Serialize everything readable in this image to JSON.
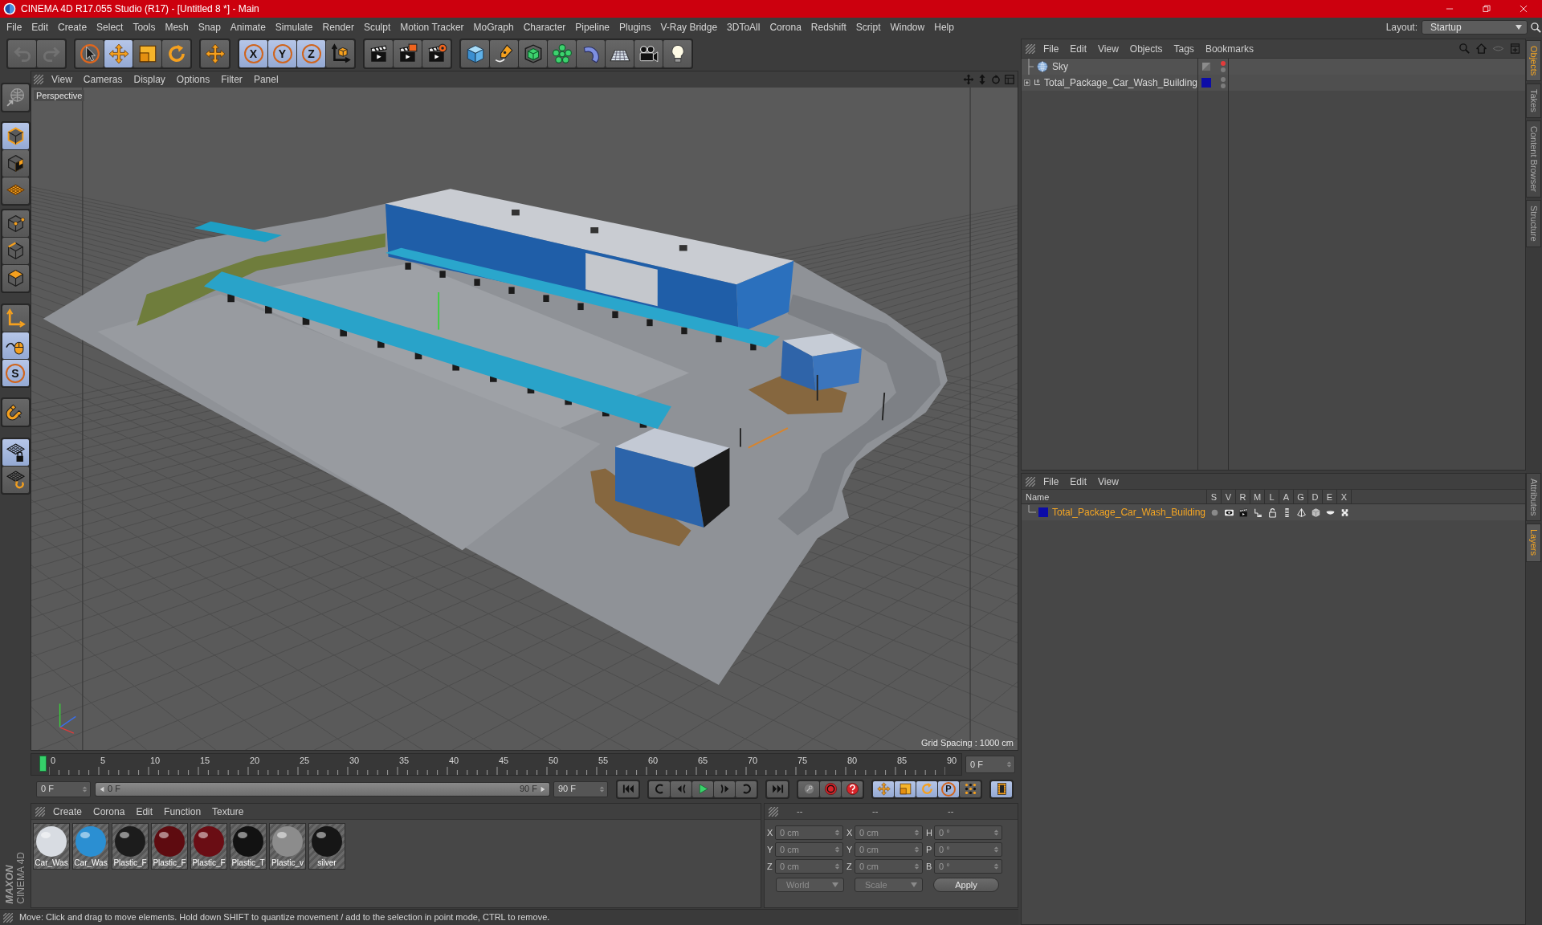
{
  "window": {
    "title": "CINEMA 4D R17.055 Studio (R17) - [Untitled 8 *] - Main"
  },
  "menu": [
    "File",
    "Edit",
    "Create",
    "Select",
    "Tools",
    "Mesh",
    "Snap",
    "Animate",
    "Simulate",
    "Render",
    "Sculpt",
    "Motion Tracker",
    "MoGraph",
    "Character",
    "Pipeline",
    "Plugins",
    "V-Ray Bridge",
    "3DToAll",
    "Corona",
    "Redshift",
    "Script",
    "Window",
    "Help"
  ],
  "layout": {
    "label": "Layout:",
    "value": "Startup"
  },
  "toolbar": [
    [
      {
        "on": false,
        "disabled": true
      },
      {
        "on": false,
        "disabled": true
      }
    ],
    [
      {
        "on": false,
        "disabled": false
      },
      {
        "on": true,
        "disabled": false
      },
      {
        "on": false,
        "disabled": false
      },
      {
        "on": false,
        "disabled": false
      }
    ],
    [
      {
        "on": false,
        "disabled": false
      }
    ],
    [
      {
        "label": "X",
        "on": true,
        "disabled": false
      },
      {
        "label": "Y",
        "on": true,
        "disabled": false
      },
      {
        "label": "Z",
        "on": true,
        "disabled": false
      },
      {
        "on": false,
        "disabled": false
      }
    ],
    [
      {
        "on": false,
        "disabled": false
      },
      {
        "on": false,
        "disabled": false
      },
      {
        "on": false,
        "disabled": false
      }
    ],
    [
      {
        "on": false,
        "disabled": false
      },
      {
        "on": false,
        "disabled": false
      },
      {
        "on": false,
        "disabled": false
      },
      {
        "on": false,
        "disabled": false
      },
      {
        "on": false,
        "disabled": false
      },
      {
        "on": false,
        "disabled": false
      },
      {
        "on": false,
        "disabled": false
      },
      {
        "on": false,
        "disabled": false
      }
    ]
  ],
  "tools": [
    [
      {
        "on": false
      }
    ],
    [
      {
        "on": true
      },
      {
        "on": false
      },
      {
        "on": false
      }
    ],
    [
      {
        "on": false
      },
      {
        "on": false
      },
      {
        "on": false
      }
    ],
    [
      {
        "on": false
      },
      {
        "on": true
      },
      {
        "label": "S",
        "on": true
      }
    ],
    [
      {
        "on": false
      }
    ],
    [
      {
        "on": true
      },
      {
        "on": false
      }
    ]
  ],
  "logo": {
    "brand": "MAXON",
    "product": "CINEMA 4D"
  },
  "viewport": {
    "menu": [
      "View",
      "Cameras",
      "Display",
      "Options",
      "Filter",
      "Panel"
    ],
    "camera": "Perspective",
    "grid_spacing": "Grid Spacing : 1000 cm"
  },
  "timeline": {
    "ticks": [
      "0",
      "5",
      "10",
      "15",
      "20",
      "25",
      "30",
      "35",
      "40",
      "45",
      "50",
      "55",
      "60",
      "65",
      "70",
      "75",
      "80",
      "85",
      "90"
    ],
    "level": 0,
    "frame": "0 F"
  },
  "transport": {
    "start": "0 F",
    "range": {
      "start": "0 F",
      "end": "90 F",
      "level": 1
    },
    "end": "90 F",
    "buttons": [
      [
        {
          "on": false
        }
      ],
      [
        {
          "on": false
        },
        {
          "on": false
        },
        {
          "on": false
        },
        {
          "on": false
        },
        {
          "on": false
        }
      ],
      [
        {
          "on": false
        }
      ],
      [
        {
          "on": false
        },
        {
          "on": false
        },
        {
          "on": false
        }
      ],
      [
        {
          "on": true
        },
        {
          "on": true
        },
        {
          "on": true
        },
        {
          "label": "P",
          "on": true
        },
        {
          "on": false
        }
      ],
      [
        {
          "on": true
        }
      ]
    ]
  },
  "materials": {
    "menu": [
      "Create",
      "Corona",
      "Edit",
      "Function",
      "Texture"
    ],
    "items": [
      {
        "name": "Car_Was",
        "color": "#d8dce2"
      },
      {
        "name": "Car_Was",
        "color": "#2b8fd2"
      },
      {
        "name": "Plastic_F",
        "color": "#1c1c1c"
      },
      {
        "name": "Plastic_F",
        "color": "#5e0b10"
      },
      {
        "name": "Plastic_F",
        "color": "#6a0d14"
      },
      {
        "name": "Plastic_T",
        "color": "#121212"
      },
      {
        "name": "Plastic_v",
        "color": "#8c8c8c"
      },
      {
        "name": "silver",
        "color": "#161616"
      }
    ]
  },
  "coordinates": {
    "headers": [
      "--",
      "--",
      "--"
    ],
    "rows": [
      [
        {
          "label": "X",
          "value": "0 cm"
        },
        {
          "label": "X",
          "value": "0 cm"
        },
        {
          "label": "H",
          "value": "0 °"
        }
      ],
      [
        {
          "label": "Y",
          "value": "0 cm"
        },
        {
          "label": "Y",
          "value": "0 cm"
        },
        {
          "label": "P",
          "value": "0 °"
        }
      ],
      [
        {
          "label": "Z",
          "value": "0 cm"
        },
        {
          "label": "Z",
          "value": "0 cm"
        },
        {
          "label": "B",
          "value": "0 °"
        }
      ]
    ],
    "mode": "World",
    "transform": "Scale",
    "apply": "Apply"
  },
  "status_bar": {
    "text": "Move: Click and drag to move elements. Hold down SHIFT to quantize movement / add to the selection in point mode, CTRL to remove."
  },
  "objects": {
    "menu": [
      "File",
      "Edit",
      "View",
      "Objects",
      "Tags",
      "Bookmarks"
    ],
    "items": [
      {
        "name": "Sky",
        "kind": "sky",
        "expandable": false,
        "has_tag": true,
        "editor_hidden": true
      },
      {
        "name": "Total_Package_Car_Wash_Building",
        "kind": "null",
        "expandable": true,
        "expanded": false,
        "has_tag": false,
        "editor_hidden": false,
        "color": "#0c0ca8"
      }
    ]
  },
  "layers": {
    "menu": [
      "File",
      "Edit",
      "View"
    ],
    "columns": [
      "Name",
      "S",
      "V",
      "R",
      "M",
      "L",
      "A",
      "G",
      "D",
      "E",
      "X"
    ],
    "items": [
      {
        "name": "Total_Package_Car_Wash_Building",
        "color": "#0c0ca8",
        "selected": true
      }
    ]
  },
  "side_tabs": {
    "top": [
      {
        "label": "Objects",
        "selected": true
      },
      {
        "label": "Takes",
        "selected": false
      },
      {
        "label": "Content Browser",
        "selected": false
      },
      {
        "label": "Structure",
        "selected": false
      }
    ],
    "bottom": [
      {
        "label": "Attributes",
        "selected": false
      },
      {
        "label": "Layers",
        "selected": true
      }
    ]
  }
}
